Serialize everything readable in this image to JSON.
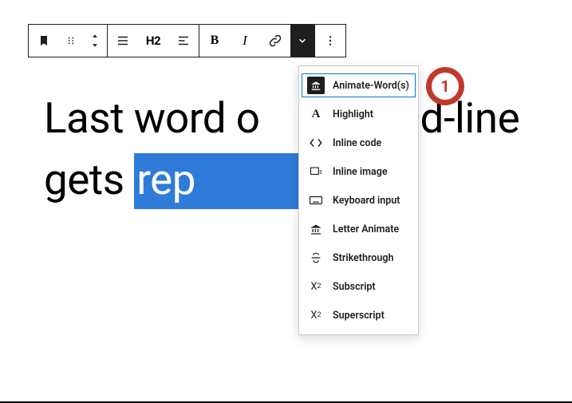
{
  "toolbar": {
    "heading_level": "H2"
  },
  "headline": {
    "part1": "Last word o",
    "part2": "head-line gets ",
    "selected": "rep          l",
    "part3": "."
  },
  "menu": {
    "items": [
      {
        "label": "Animate-Word(s)"
      },
      {
        "label": "Highlight"
      },
      {
        "label": "Inline code"
      },
      {
        "label": "Inline image"
      },
      {
        "label": "Keyboard input"
      },
      {
        "label": "Letter Animate"
      },
      {
        "label": "Strikethrough"
      },
      {
        "label": "Subscript"
      },
      {
        "label": "Superscript"
      }
    ]
  },
  "callout": {
    "number": "1"
  }
}
